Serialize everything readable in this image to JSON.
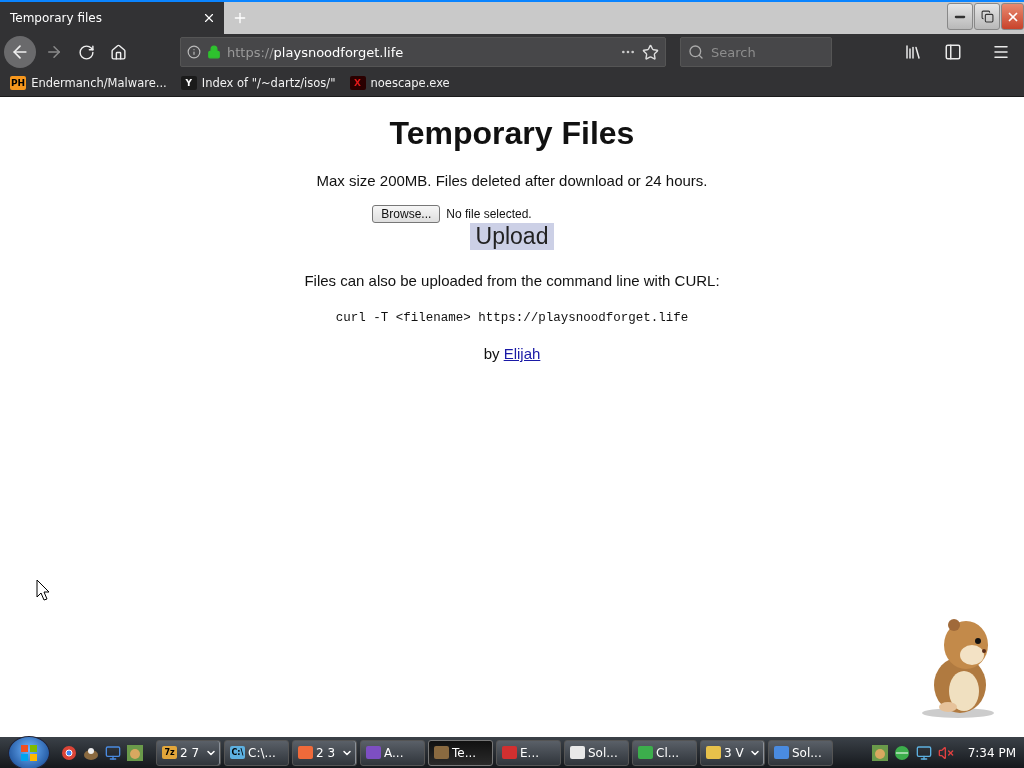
{
  "tab": {
    "title": "Temporary files",
    "selected": true
  },
  "address": {
    "scheme": "https://",
    "host": "playsnoodforget.life"
  },
  "search": {
    "placeholder": "Search"
  },
  "bookmarks": [
    {
      "badge": "PH",
      "label": "Endermanch/Malware..."
    },
    {
      "badge": "Y",
      "label": "Index of \"/~dartz/isos/\""
    },
    {
      "badge": "X",
      "label": "noescape.exe"
    }
  ],
  "page": {
    "heading": "Temporary Files",
    "note": "Max size 200MB. Files deleted after download or 24 hours.",
    "browse_button": "Browse...",
    "file_status": "No file selected.",
    "upload_button": "Upload",
    "cli_note": "Files can also be uploaded from the command line with CURL:",
    "command": "curl -T <filename> https://playsnoodforget.life",
    "byline": "by",
    "author_link": "Elijah"
  },
  "taskbar": {
    "items": [
      {
        "icon_text": "7z",
        "label": "2 7",
        "grouped": true,
        "selected": false
      },
      {
        "icon_text": "C:\\",
        "label": "C:\\...",
        "grouped": false,
        "selected": false
      },
      {
        "label": "2 3",
        "grouped": true,
        "selected": false
      },
      {
        "label": "A...",
        "grouped": false,
        "selected": false
      },
      {
        "label": "Te...",
        "grouped": false,
        "selected": true
      },
      {
        "label": "E...",
        "grouped": false,
        "selected": false
      },
      {
        "label": "Sol...",
        "grouped": false,
        "selected": false
      },
      {
        "label": "Cl...",
        "grouped": false,
        "selected": false
      },
      {
        "label": "3 V",
        "grouped": true,
        "selected": false
      },
      {
        "label": "Sol...",
        "grouped": false,
        "selected": false
      }
    ],
    "clock": "7:34 PM"
  }
}
